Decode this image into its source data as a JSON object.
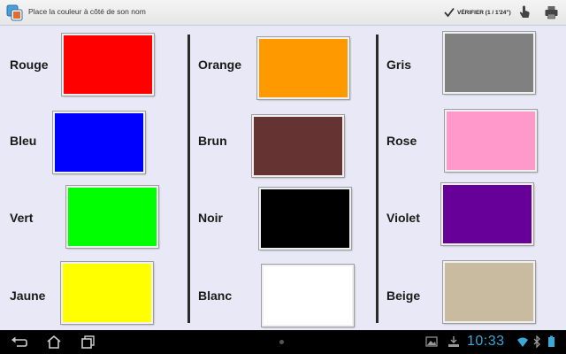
{
  "header": {
    "title": "Place la couleur à côté de son nom",
    "verify_label": "VÉRIFIER  (1 / 1'24\")"
  },
  "columns": [
    {
      "items": [
        {
          "name": "Rouge",
          "color": "#ff0000"
        },
        {
          "name": "Bleu",
          "color": "#0000ff"
        },
        {
          "name": "Vert",
          "color": "#00ff00"
        },
        {
          "name": "Jaune",
          "color": "#ffff00"
        }
      ]
    },
    {
      "items": [
        {
          "name": "Orange",
          "color": "#ff9900"
        },
        {
          "name": "Brun",
          "color": "#663333"
        },
        {
          "name": "Noir",
          "color": "#000000"
        },
        {
          "name": "Blanc",
          "color": "#ffffff"
        }
      ]
    },
    {
      "items": [
        {
          "name": "Gris",
          "color": "#808080"
        },
        {
          "name": "Rose",
          "color": "#ff99cc"
        },
        {
          "name": "Violet",
          "color": "#660099"
        },
        {
          "name": "Beige",
          "color": "#c8bb9f"
        }
      ]
    }
  ],
  "system_bar": {
    "clock": "10:33"
  },
  "icons": {
    "app": "app-icon",
    "verify": "checkmark-icon",
    "hint": "hand-pointer-icon",
    "print": "printer-icon",
    "back": "back-icon",
    "home": "home-icon",
    "recents": "recent-apps-icon"
  },
  "colors": {
    "background": "#e8e8f6",
    "clock": "#3aa8d8"
  }
}
